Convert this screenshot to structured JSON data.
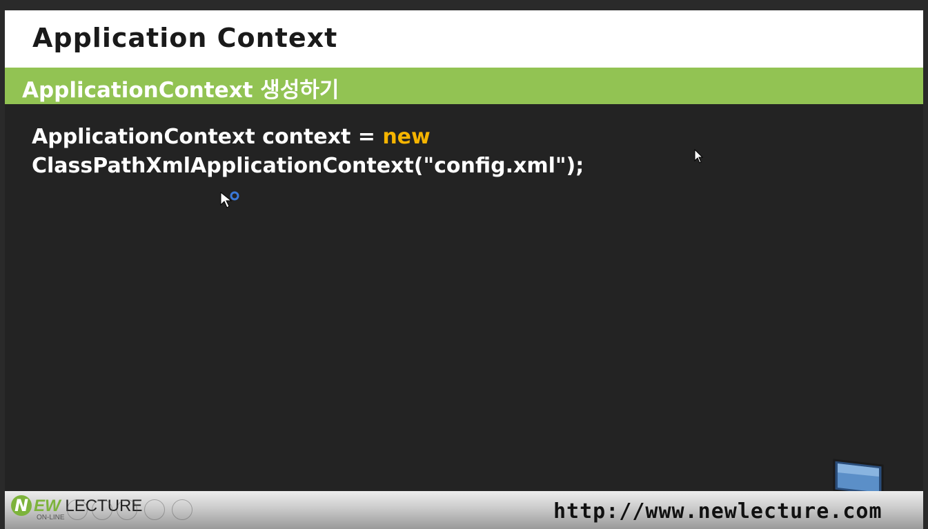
{
  "slide": {
    "title": "Application Context",
    "subtitle": "ApplicationContext 생성하기",
    "code": {
      "line1_before": "ApplicationContext context = ",
      "line1_keyword": "new",
      "line2": "ClassPathXmlApplicationContext(\"config.xml\");"
    }
  },
  "footer": {
    "logo_letter": "N",
    "logo_ew": "EW",
    "logo_lecture": " LECTURE",
    "logo_sub": "ON-LINE",
    "url": "http://www.newlecture.com"
  },
  "colors": {
    "subtitle_bar": "#92c353",
    "keyword": "#f5b400",
    "slide_bg": "#232323",
    "cursor_ring": "#3a78d8"
  },
  "icons": [
    "mouse-pointer-icon",
    "busy-pointer-icon",
    "computer-icon",
    "player-control-icon"
  ]
}
